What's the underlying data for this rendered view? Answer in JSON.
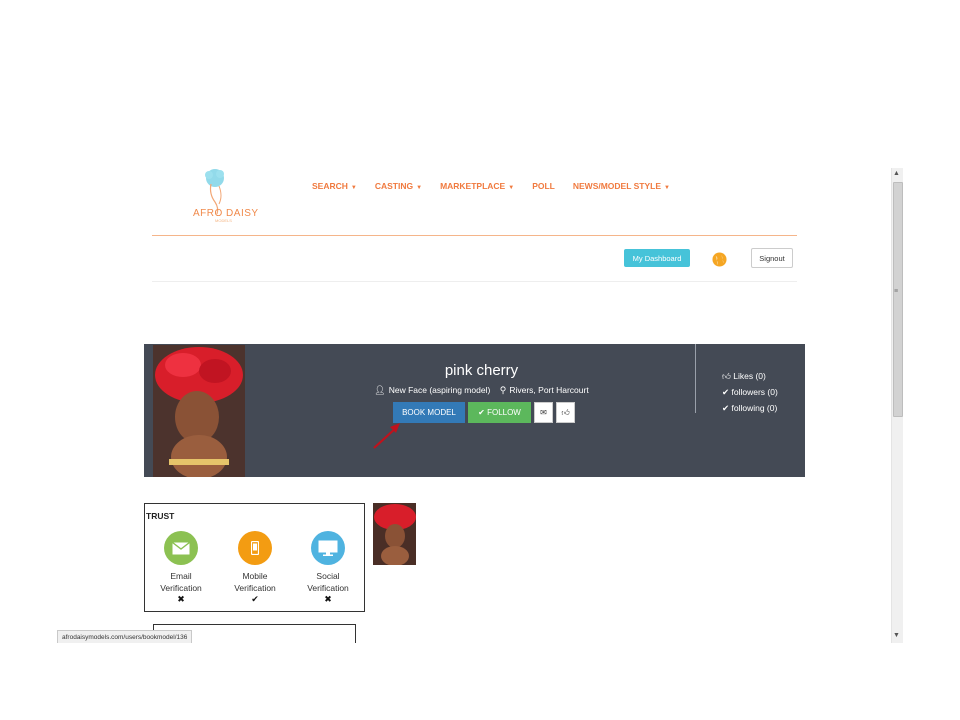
{
  "brand": {
    "logo_text": "AFRO DAISY",
    "logo_sub": "MODELS"
  },
  "nav": [
    {
      "label": "SEARCH",
      "dropdown": true
    },
    {
      "label": "CASTING",
      "dropdown": true
    },
    {
      "label": "MARKETPLACE",
      "dropdown": true
    },
    {
      "label": "POLL",
      "dropdown": false
    },
    {
      "label": "NEWS/MODEL STYLE",
      "dropdown": true
    }
  ],
  "header": {
    "dashboard_label": "My Dashboard",
    "signout_label": "Signout",
    "globe_icon": "globe-icon"
  },
  "profile": {
    "name": "pink cherry",
    "category": "New Face (aspiring model)",
    "location": "Rivers, Port Harcourt",
    "book_label": "BOOK MODEL",
    "follow_label": "FOLLOW",
    "likes": "Likes (0)",
    "followers": "followers (0)",
    "following": "following (0)"
  },
  "trust": {
    "title": "TRUST",
    "items": [
      {
        "line1": "Email",
        "line2": "Verification",
        "status": "✖",
        "color": "#8cc152",
        "icon": "envelope-icon"
      },
      {
        "line1": "Mobile",
        "line2": "Verification",
        "status": "✔",
        "color": "#f39c12",
        "icon": "mobile-phone-icon"
      },
      {
        "line1": "Social",
        "line2": "Verification",
        "status": "✖",
        "color": "#4fb3e0",
        "icon": "monitor-icon"
      }
    ]
  },
  "status_bar": {
    "url": "afrodaisymodels.com/users/bookmodel/136"
  },
  "colors": {
    "accent": "#f07a3f",
    "banner": "#444a55",
    "book": "#337ab7",
    "follow": "#5cb85c",
    "dashboard": "#46c3d9"
  }
}
